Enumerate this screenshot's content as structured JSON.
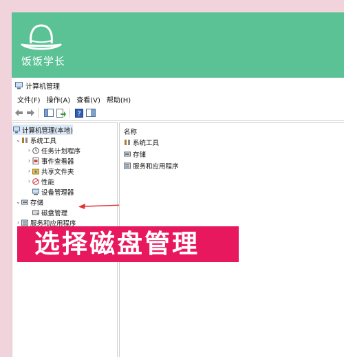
{
  "banner": {
    "brand": "饭饭学长",
    "color": "#5bc296"
  },
  "window": {
    "title": "计算机管理"
  },
  "menu": [
    "文件(F)",
    "操作(A)",
    "查看(V)",
    "帮助(H)"
  ],
  "toolbar": {
    "icons": [
      "back-arrow-icon",
      "forward-arrow-icon",
      "console-tree-icon",
      "export-icon",
      "help-icon",
      "panel-icon"
    ]
  },
  "tree": {
    "root": "计算机管理(本地)",
    "system_tools": {
      "label": "系统工具",
      "children": [
        "任务计划程序",
        "事件查看器",
        "共享文件夹",
        "性能",
        "设备管理器"
      ]
    },
    "storage": {
      "label": "存储",
      "children": [
        "磁盘管理"
      ]
    },
    "services": "服务和应用程序"
  },
  "list": {
    "header": "名称",
    "items": [
      "系统工具",
      "存储",
      "服务和应用程序"
    ]
  },
  "callout": {
    "text": "选择磁盘管理",
    "color": "#e8185f"
  }
}
